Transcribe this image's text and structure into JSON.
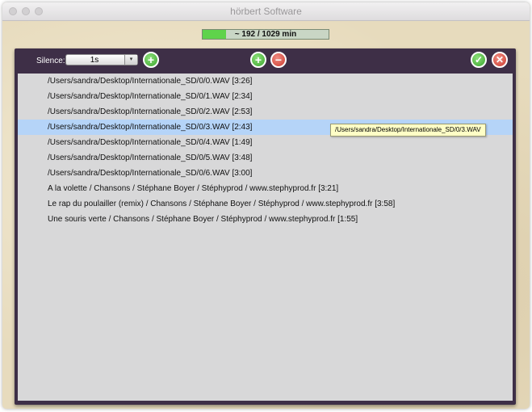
{
  "window": {
    "title": "hörbert Software"
  },
  "capacity": {
    "text": "~ 192 / 1029 min",
    "used_fraction": 0.187
  },
  "toolbar": {
    "silence_label": "Silence:",
    "silence_value": "1s",
    "silence_arrow": "▾",
    "add_silence_glyph": "+",
    "add_track_glyph": "+",
    "remove_track_glyph": "−",
    "confirm_glyph": "✓",
    "cancel_glyph": "✕"
  },
  "tracks": [
    "/Users/sandra/Desktop/Internationale_SD/0/0.WAV [3:26]",
    "/Users/sandra/Desktop/Internationale_SD/0/1.WAV [2:34]",
    "/Users/sandra/Desktop/Internationale_SD/0/2.WAV [2:53]",
    "/Users/sandra/Desktop/Internationale_SD/0/3.WAV [2:43]",
    "/Users/sandra/Desktop/Internationale_SD/0/4.WAV [1:49]",
    "/Users/sandra/Desktop/Internationale_SD/0/5.WAV [3:48]",
    "/Users/sandra/Desktop/Internationale_SD/0/6.WAV [3:00]",
    "A la volette / Chansons / Stéphane Boyer / Stéphyprod / www.stephyprod.fr [3:21]",
    "Le rap du poulailler (remix) / Chansons / Stéphane Boyer / Stéphyprod / www.stephyprod.fr [3:58]",
    "Une souris verte / Chansons / Stéphane Boyer / Stéphyprod / www.stephyprod.fr [1:55]"
  ],
  "selected_index": 3,
  "tooltip": "/Users/sandra/Desktop/Internationale_SD/0/3.WAV",
  "colors": {
    "panel": "#3e2f47",
    "selection": "#b5d4f8",
    "capacity_fill": "#5fd34b",
    "add_button": "#3aa52c",
    "remove_button": "#cc3b30"
  }
}
